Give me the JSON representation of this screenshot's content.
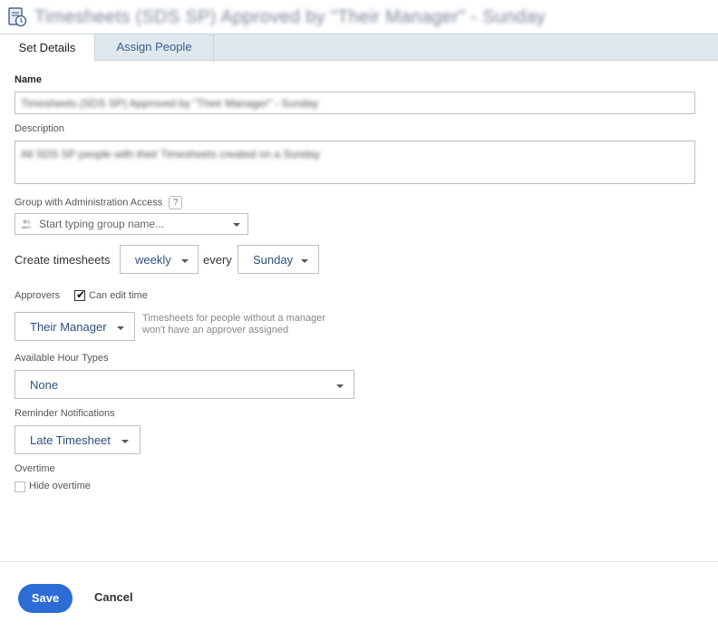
{
  "window": {
    "title": "Timesheets (SDS SP) Approved by \"Their Manager\" - Sunday",
    "icon": "timesheet-gear-icon"
  },
  "tabs": [
    {
      "label": "Set Details",
      "active": true
    },
    {
      "label": "Assign People",
      "active": false
    }
  ],
  "form": {
    "name": {
      "label": "Name",
      "value": "Timesheets (SDS SP) Approved by \"Their Manager\" - Sunday"
    },
    "description": {
      "label": "Description",
      "value": "All SDS SP people with their Timesheets created on a Sunday"
    },
    "group_admin": {
      "label": "Group with Administration Access",
      "help": "?",
      "placeholder": "Start typing group name..."
    },
    "create_timesheets": {
      "label": "Create timesheets",
      "frequency": "weekly",
      "every_label": "every",
      "day": "Sunday"
    },
    "approvers": {
      "label": "Approvers",
      "can_edit_label": "Can edit time",
      "can_edit_checked": true,
      "value": "Their Manager",
      "hint_line1": "Timesheets for people without a manager",
      "hint_line2": "won't have an approver assigned"
    },
    "hour_types": {
      "label": "Available Hour Types",
      "value": "None"
    },
    "reminders": {
      "label": "Reminder Notifications",
      "value": "Late Timesheet"
    },
    "overtime": {
      "label": "Overtime",
      "hide_label": "Hide overtime",
      "hide_checked": false
    }
  },
  "footer": {
    "save_label": "Save",
    "cancel_label": "Cancel"
  },
  "colors": {
    "accent": "#2d6cd4",
    "link": "#2e4f7e",
    "tab_bar": "#dfe7ef"
  }
}
